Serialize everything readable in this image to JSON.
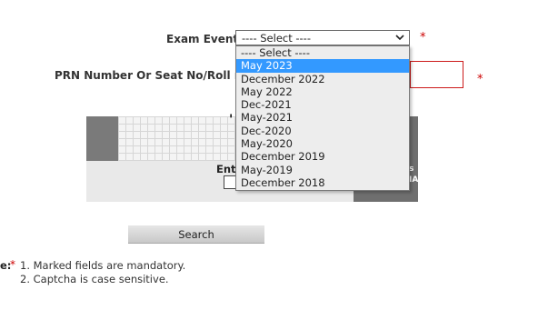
{
  "form": {
    "exam_event_label": "Exam Event:",
    "exam_event_selected": "---- Select ----",
    "required_mark": "*",
    "prn_label": "PRN Number Or Seat No/Roll no:"
  },
  "dropdown": {
    "options": [
      "---- Select ----",
      "May 2023",
      "December 2022",
      "May 2022",
      "Dec-2021",
      "May-2021",
      "Dec-2020",
      "May-2020",
      "December 2019",
      "May-2019",
      "December 2018"
    ],
    "highlighted_index": 1
  },
  "captcha": {
    "label_partial": "Ent",
    "char_partial": "'",
    "side_text_1": "s",
    "side_text_2": "IA"
  },
  "search_button": {
    "label": "Search"
  },
  "notes": {
    "prefix": "e:",
    "star": "*",
    "items": [
      "1. Marked fields are mandatory.",
      "2. Captcha is case sensitive."
    ]
  },
  "colors": {
    "highlight": "#3399ff",
    "required": "#cc0000",
    "input_error_border": "#cc1a1a"
  }
}
